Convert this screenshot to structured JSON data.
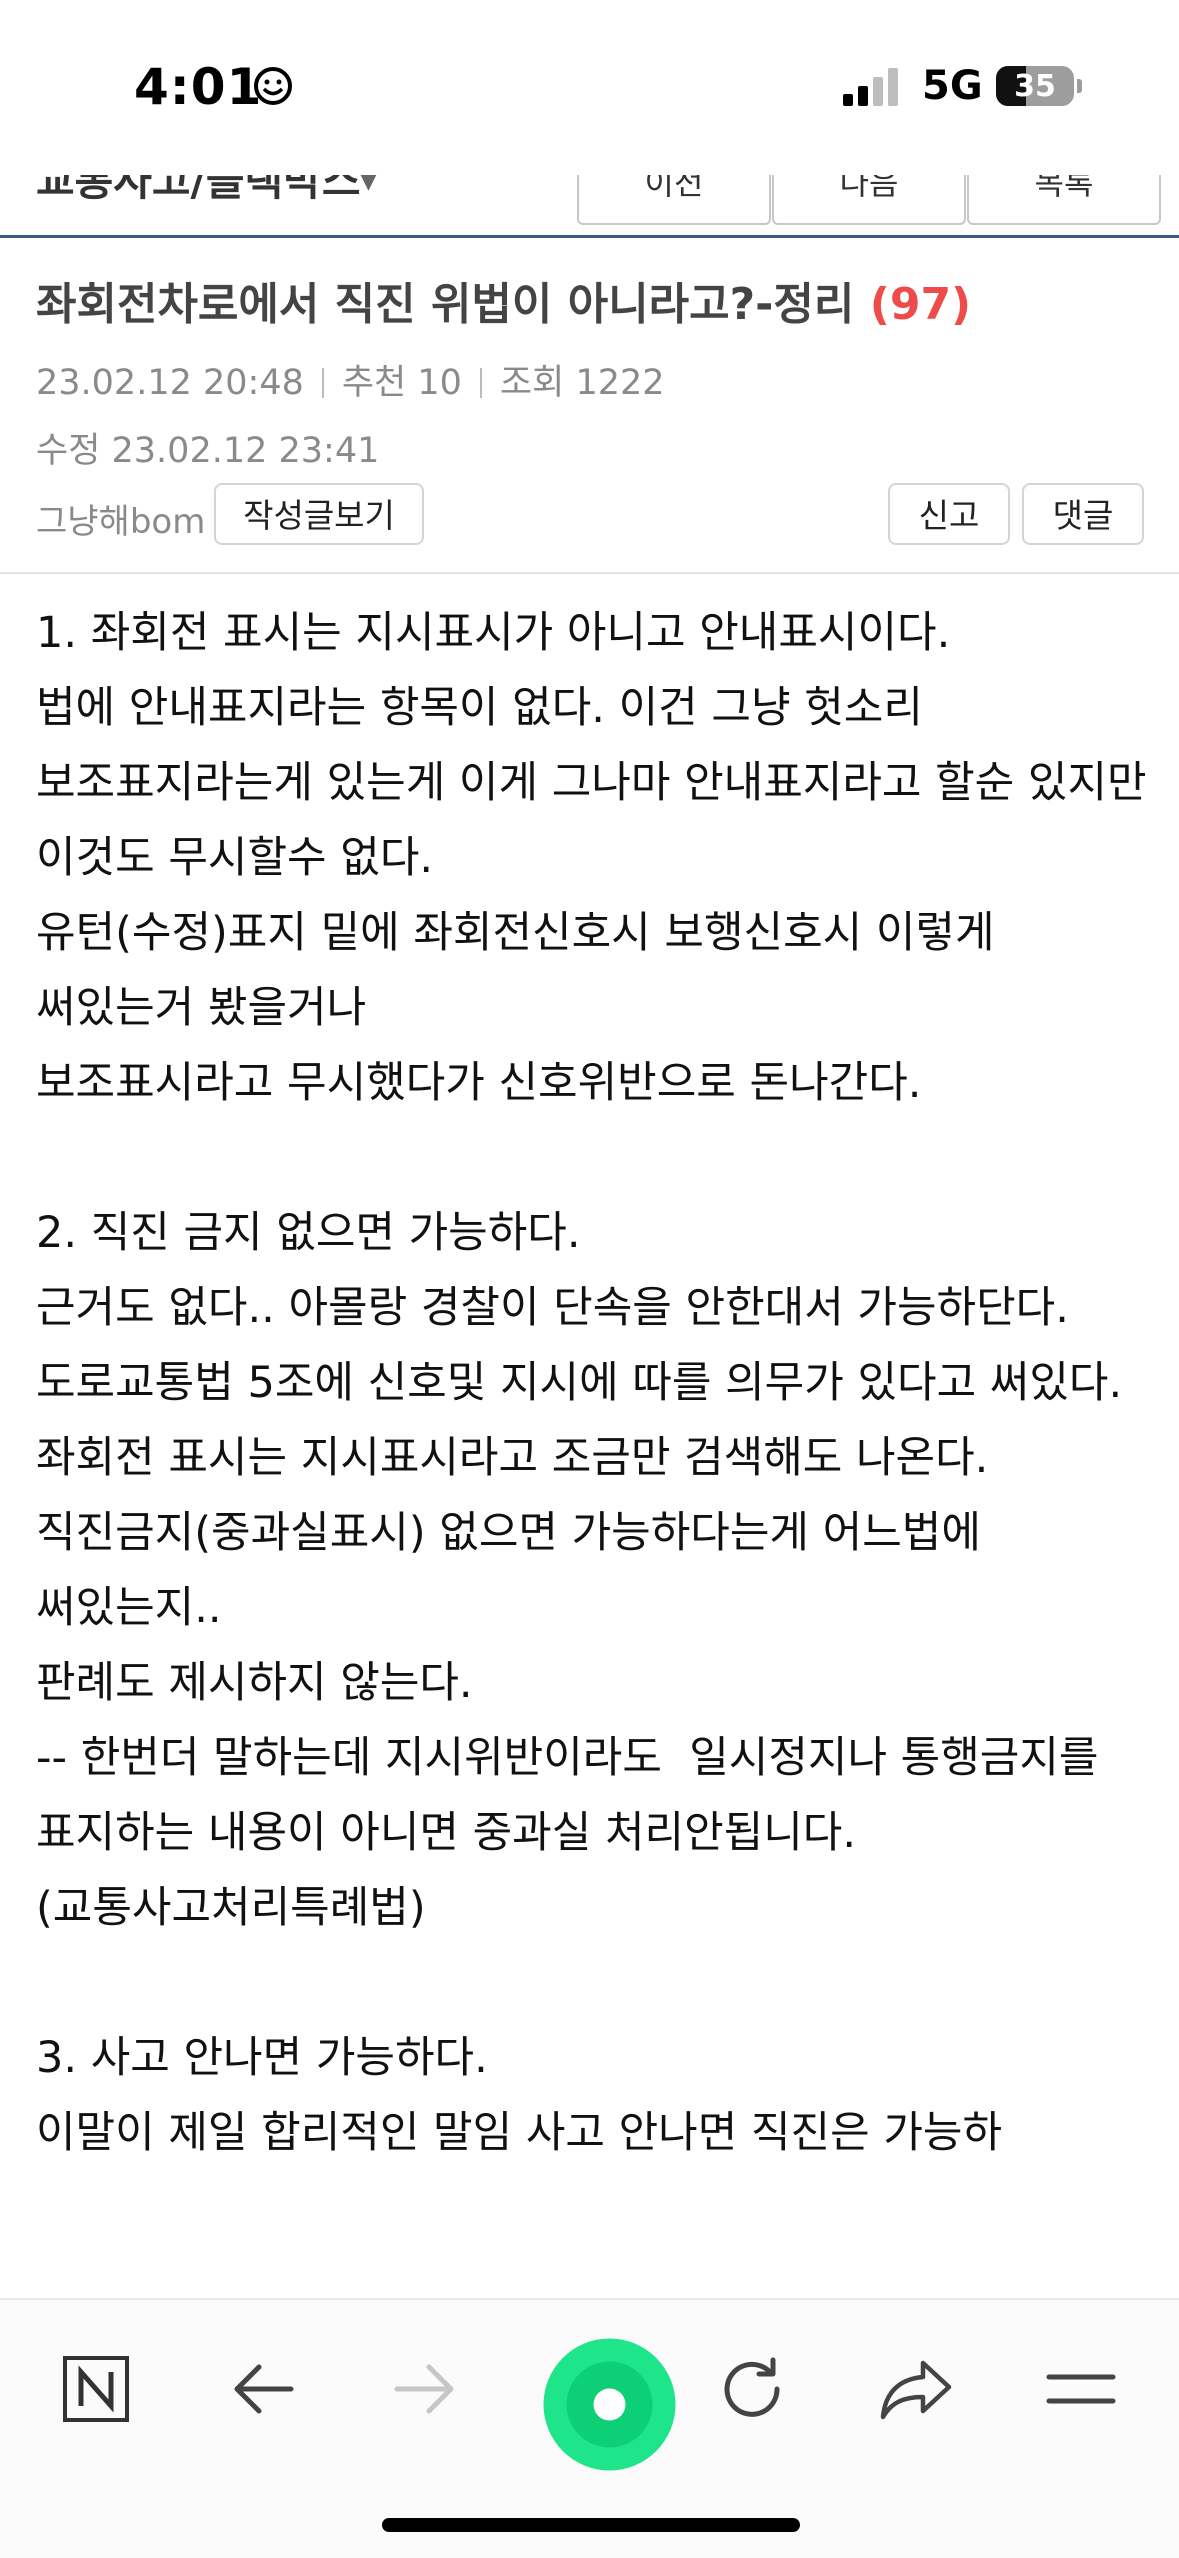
{
  "status_bar": {
    "time": "4:01",
    "network": "5G",
    "battery": "35"
  },
  "nav": {
    "board_name": "교통사고/블랙박스",
    "prev_label": "이전",
    "next_label": "다음",
    "list_label": "목록"
  },
  "post": {
    "title": "좌회전차로에서 직진 위법이 아니라고?-정리",
    "comment_count": "(97)",
    "date": "23.02.12  20:48",
    "recommend": "추천 10",
    "views": "조회 1222",
    "modified": "수정 23.02.12  23:41",
    "author": "그냥해bom",
    "view_posts_label": "작성글보기",
    "report_label": "신고",
    "comment_label": "댓글"
  },
  "content": {
    "section1": "1. 좌회전 표시는 지시표시가 아니고 안내표시이다.\n법에 안내표지라는 항목이 없다. 이건 그냥 헛소리\n보조표지라는게 있는게 이게 그나마 안내표지라고 할순 있지만 이것도 무시할수 없다.\n유턴(수정)표지 밑에 좌회전신호시 보행신호시 이렇게 써있는거 봤을거나\n보조표시라고 무시했다가 신호위반으로 돈나간다.",
    "section2": "2. 직진 금지 없으면 가능하다.\n근거도 없다.. 아몰랑 경찰이 단속을 안한대서 가능하단다.\n도로교통법 5조에 신호및 지시에 따를 의무가 있다고 써있다.\n좌회전 표시는 지시표시라고 조금만 검색해도 나온다.\n직진금지(중과실표시) 없으면 가능하다는게 어느법에 써있는지..\n판례도 제시하지 않는다.\n-- 한번더 말하는데 지시위반이라도  일시정지나 통행금지를 표지하는 내용이 아니면 중과실 처리안됩니다. (교통사고처리특례법)",
    "section3": "3. 사고 안나면 가능하다.\n이말이 제일 합리적인 말임 사고 안나면 직진은 가능하"
  },
  "toolbar": {
    "icons": [
      "naver-n-icon",
      "back-arrow-icon",
      "forward-arrow-icon",
      "green-dot-icon",
      "refresh-icon",
      "share-icon",
      "menu-icon"
    ]
  },
  "colors": {
    "accent_red": "#ee4b4b",
    "green_button": "#1ee58a",
    "nav_border": "#3b5a86"
  }
}
